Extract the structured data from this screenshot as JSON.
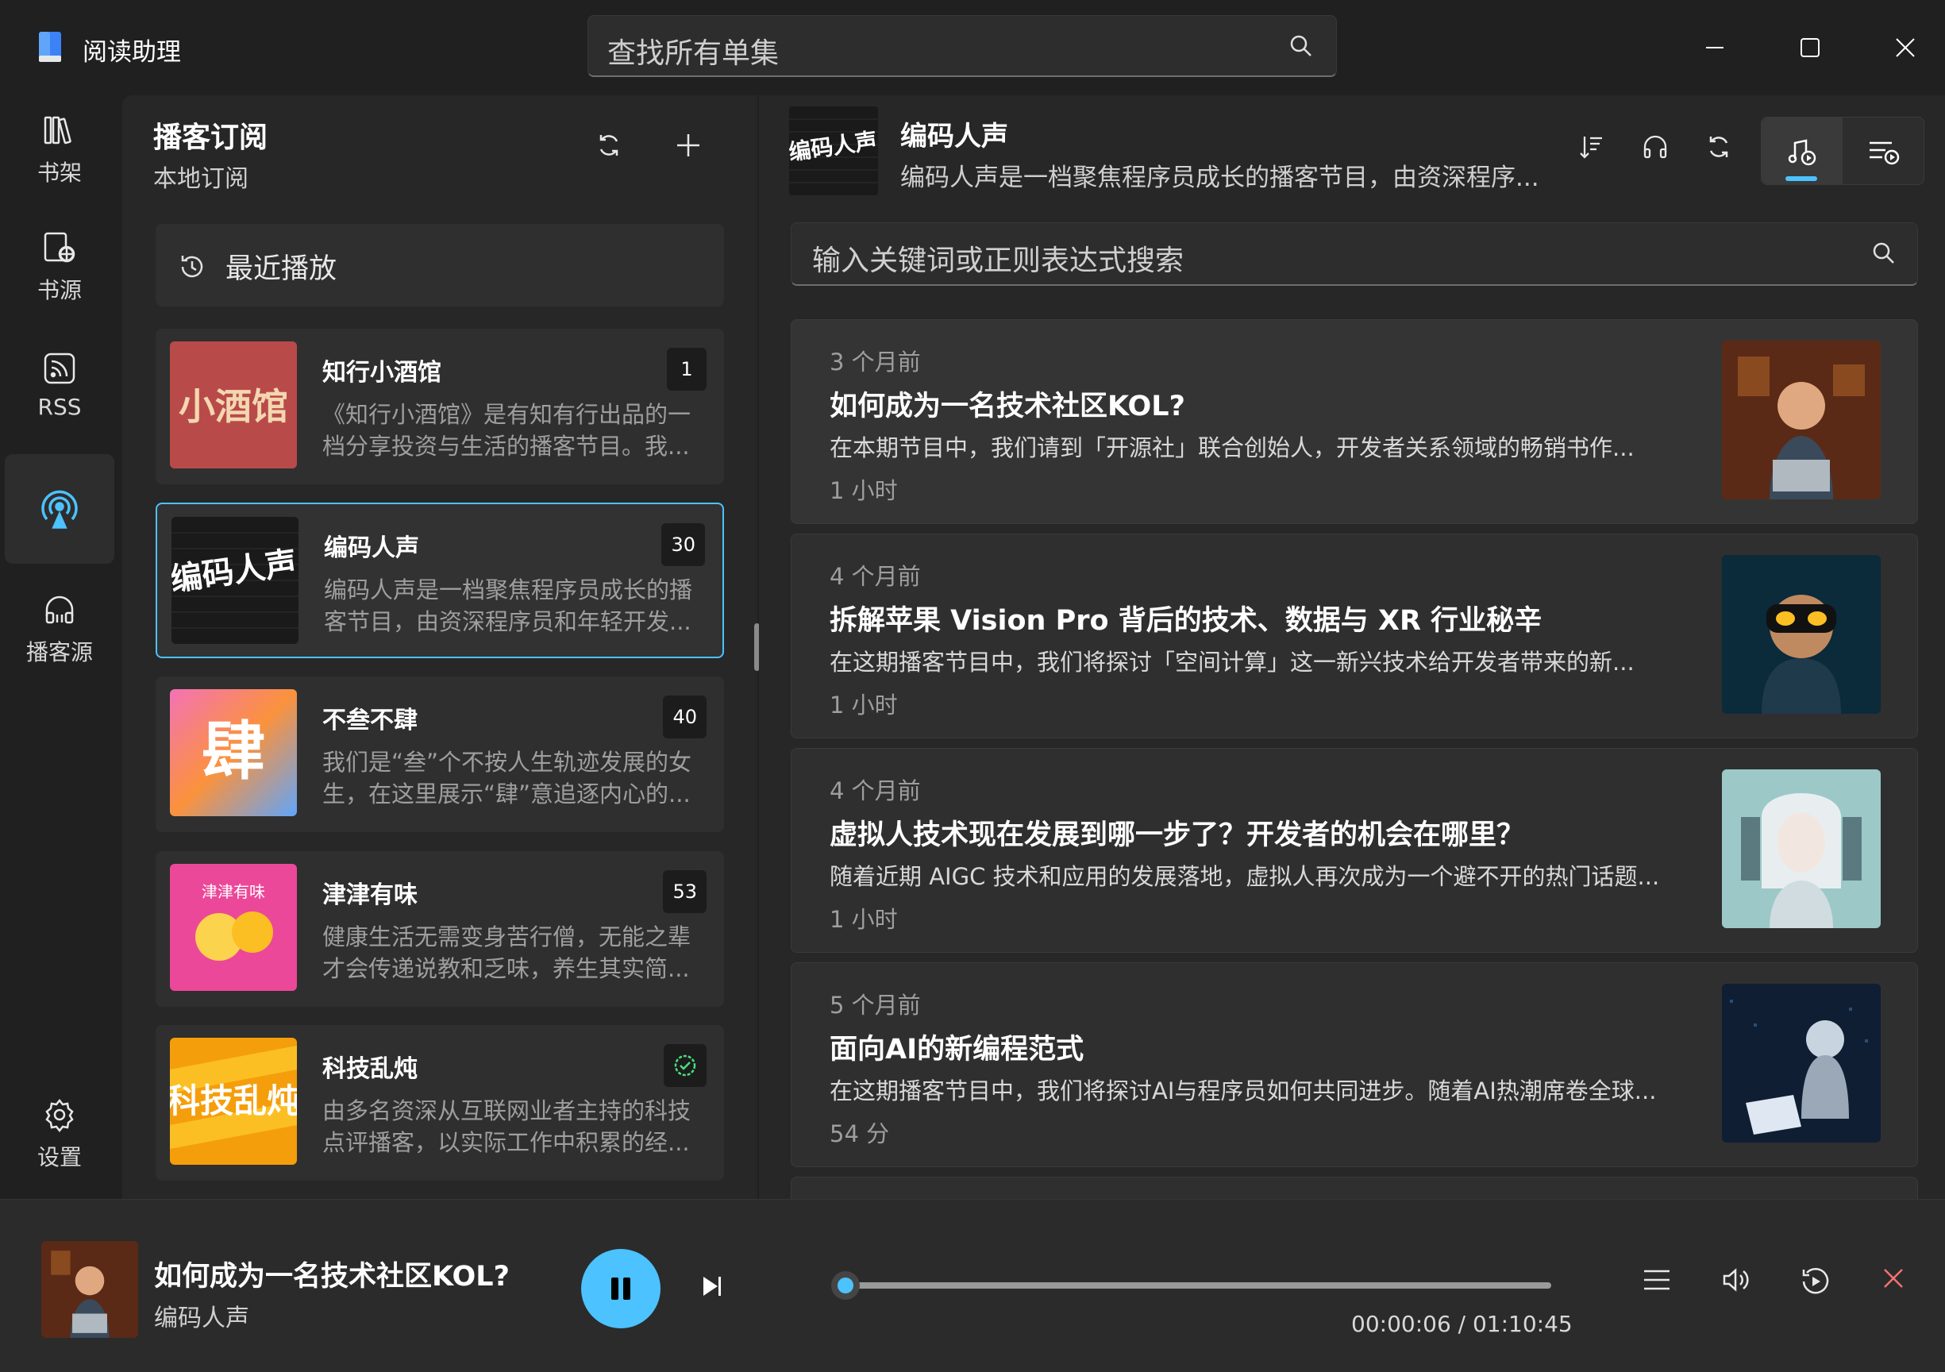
{
  "app": {
    "title": "阅读助理"
  },
  "search": {
    "placeholder": "查找所有单集"
  },
  "rail": {
    "items": [
      {
        "label": "书架",
        "icon": "bookshelf-icon"
      },
      {
        "label": "书源",
        "icon": "book-source-icon"
      },
      {
        "label": "RSS",
        "icon": "rss-icon"
      },
      {
        "label": "",
        "icon": "podcast-icon",
        "active": true
      },
      {
        "label": "播客源",
        "icon": "headphones-icon"
      }
    ],
    "settings_label": "设置"
  },
  "subscriptions": {
    "title": "播客订阅",
    "subtitle": "本地订阅",
    "recent_label": "最近播放",
    "podcasts": [
      {
        "name": "知行小酒馆",
        "badge": "1",
        "description": "《知行小酒馆》是有知有行出品的一档分享投资与生活的播客节目。我...",
        "cover_text": "小酒馆"
      },
      {
        "name": "编码人声",
        "badge": "30",
        "description": "编码人声是一档聚焦程序员成长的播客节目，由资深程序员和年轻开发...",
        "cover_text": "编码人声",
        "selected": true
      },
      {
        "name": "不叁不肆",
        "badge": "40",
        "description": "我们是“叁”个不按人生轨迹发展的女生，在这里展示“肆”意追逐内心的...",
        "cover_text": "肆"
      },
      {
        "name": "津津有味",
        "badge": "53",
        "description": "健康生活无需变身苦行僧，无能之辈才会传递说教和乏味，养生其实简...",
        "cover_text": "津津有味"
      },
      {
        "name": "科技乱炖",
        "badge": "",
        "badge_icon": "check-circle-icon",
        "description": "由多名资深从互联网业者主持的科技点评播客，以实际工作中积累的经...",
        "cover_text": "科技乱炖"
      }
    ]
  },
  "show": {
    "title": "编码人声",
    "description": "编码人声是一档聚焦程序员成长的播客节目，由资深程序...",
    "cover_text": "编码人声"
  },
  "episode_search": {
    "placeholder": "输入关键词或正则表达式搜索"
  },
  "episodes": [
    {
      "time_ago": "3 个月前",
      "title": "如何成为一名技术社区KOL?",
      "description": "在本期节目中，我们请到「开源社」联合创始人，开发者关系领域的畅销书作...",
      "duration": "1 小时"
    },
    {
      "time_ago": "4 个月前",
      "title": "拆解苹果 Vision Pro 背后的技术、数据与 XR 行业秘辛",
      "description": "在这期播客节目中，我们将探讨「空间计算」这一新兴技术给开发者带来的新...",
      "duration": "1 小时"
    },
    {
      "time_ago": "4 个月前",
      "title": "虚拟人技术现在发展到哪一步了？开发者的机会在哪里？",
      "description": "随着近期 AIGC 技术和应用的发展落地，虚拟人再次成为一个避不开的热门话题...",
      "duration": "1 小时"
    },
    {
      "time_ago": "5 个月前",
      "title": "面向AI的新编程范式",
      "description": "在这期播客节目中，我们将探讨AI与程序员如何共同进步。随着AI热潮席卷全球...",
      "duration": "54 分"
    }
  ],
  "player": {
    "title": "如何成为一名技术社区KOL?",
    "subtitle": "编码人声",
    "time": "00:00:06 / 01:10:45",
    "progress": 0.001
  },
  "colors": {
    "accent": "#4cc2ff",
    "background": "#202020",
    "panel": "#272727",
    "card": "#2f2f2f"
  }
}
